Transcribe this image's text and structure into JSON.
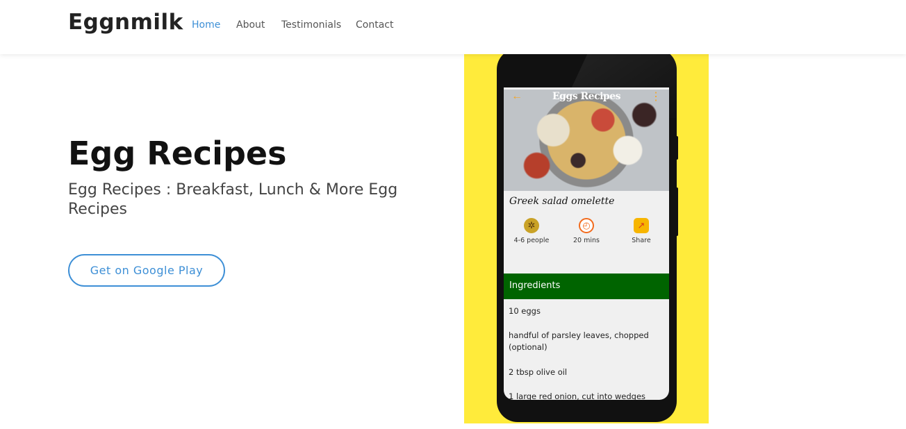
{
  "nav": {
    "brand": "Eggnmilk",
    "links": [
      {
        "label": "Home",
        "active": true
      },
      {
        "label": "About",
        "active": false
      },
      {
        "label": "Testimonials",
        "active": false
      },
      {
        "label": "Contact",
        "active": false
      }
    ]
  },
  "hero": {
    "title": "Egg Recipes",
    "subtitle": "Egg Recipes : Breakfast, Lunch & More Egg Recipes",
    "cta_label": "Get on Google Play"
  },
  "mockup": {
    "background_color": "#ffeb3b",
    "app_title": "Eggs Recipes",
    "recipe_name": "Greek salad omelette",
    "stats": [
      {
        "icon": "servings-icon",
        "label": "4-6 people"
      },
      {
        "icon": "timer-icon",
        "label": "20 mins"
      },
      {
        "icon": "share-icon",
        "label": "Share"
      }
    ],
    "ingredients_header": "Ingredients",
    "ingredients": [
      "10 eggs",
      "handful of parsley leaves, chopped (optional)",
      "2 tbsp olive oil",
      "1 large red onion, cut into wedges"
    ]
  },
  "colors": {
    "accent": "#3d8fd6",
    "ingredients_bar": "#006400",
    "app_icon_accent": "#f5a623"
  }
}
